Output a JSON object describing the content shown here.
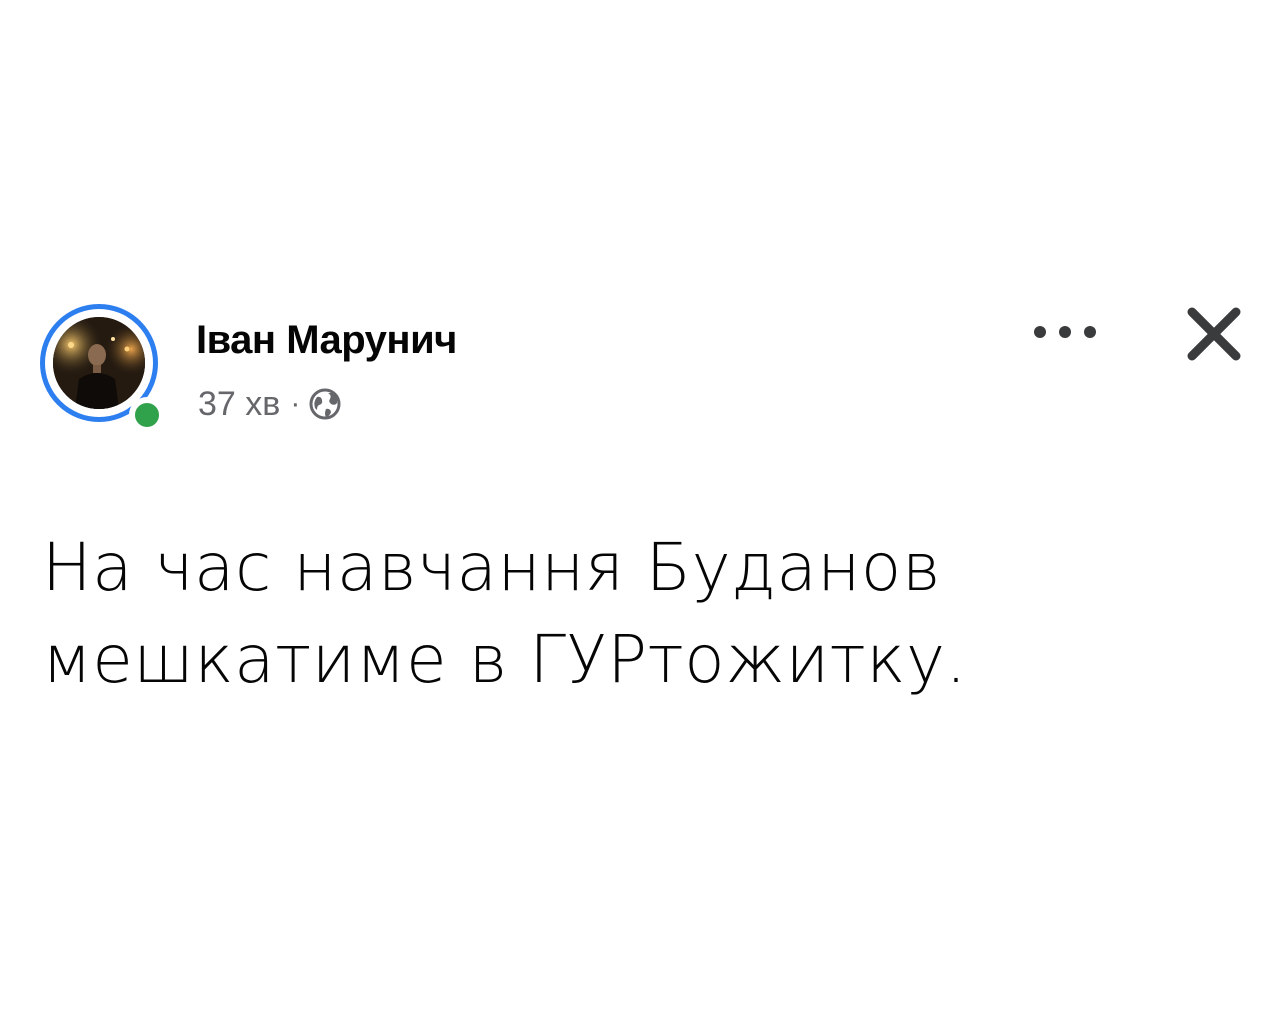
{
  "post": {
    "author_name": "Іван Марунич",
    "timestamp": "37 хв",
    "separator": "·",
    "audience_icon": "globe-icon",
    "text_lines": [
      "На час навчання Буданов",
      "мешкатиме в ГУРтожитку."
    ]
  },
  "controls": {
    "more_icon": "more-horizontal-icon",
    "close_icon": "close-icon"
  },
  "colors": {
    "story_ring": "#2d7ff0",
    "online_status": "#31a24c",
    "meta_text": "#65676b",
    "primary_text": "#050505"
  }
}
